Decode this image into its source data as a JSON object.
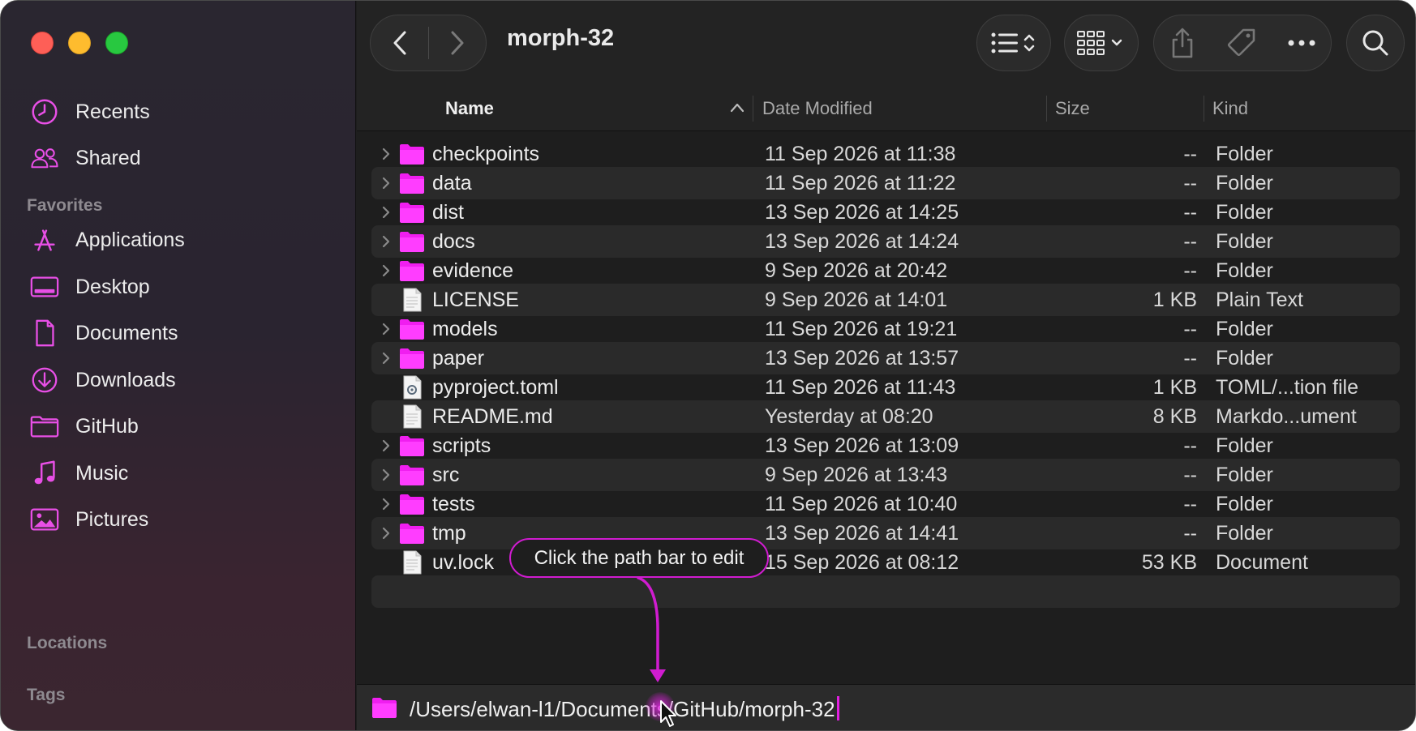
{
  "window": {
    "title": "morph-32"
  },
  "sidebar": {
    "items_top": [
      {
        "label": "Recents",
        "icon": "clock-icon"
      },
      {
        "label": "Shared",
        "icon": "people-icon"
      }
    ],
    "favorites_header": "Favorites",
    "favorites": [
      {
        "label": "Applications",
        "icon": "applications-icon"
      },
      {
        "label": "Desktop",
        "icon": "desktop-icon"
      },
      {
        "label": "Documents",
        "icon": "document-icon"
      },
      {
        "label": "Downloads",
        "icon": "download-icon"
      },
      {
        "label": "GitHub",
        "icon": "folder-icon"
      },
      {
        "label": "Music",
        "icon": "music-icon"
      },
      {
        "label": "Pictures",
        "icon": "pictures-icon"
      }
    ],
    "locations_header": "Locations",
    "tags_header": "Tags"
  },
  "columns": {
    "name": "Name",
    "date": "Date Modified",
    "size": "Size",
    "kind": "Kind"
  },
  "files": [
    {
      "name": "checkpoints",
      "date": "11 Sep 2026 at 11:38",
      "size": "--",
      "kind": "Folder",
      "type": "folder"
    },
    {
      "name": "data",
      "date": "11 Sep 2026 at 11:22",
      "size": "--",
      "kind": "Folder",
      "type": "folder"
    },
    {
      "name": "dist",
      "date": "13 Sep 2026 at 14:25",
      "size": "--",
      "kind": "Folder",
      "type": "folder"
    },
    {
      "name": "docs",
      "date": "13 Sep 2026 at 14:24",
      "size": "--",
      "kind": "Folder",
      "type": "folder"
    },
    {
      "name": "evidence",
      "date": "9 Sep 2026 at 20:42",
      "size": "--",
      "kind": "Folder",
      "type": "folder"
    },
    {
      "name": "LICENSE",
      "date": "9 Sep 2026 at 14:01",
      "size": "1 KB",
      "kind": "Plain Text",
      "type": "text"
    },
    {
      "name": "models",
      "date": "11 Sep 2026 at 19:21",
      "size": "--",
      "kind": "Folder",
      "type": "folder"
    },
    {
      "name": "paper",
      "date": "13 Sep 2026 at 13:57",
      "size": "--",
      "kind": "Folder",
      "type": "folder"
    },
    {
      "name": "pyproject.toml",
      "date": "11 Sep 2026 at 11:43",
      "size": "1 KB",
      "kind": "TOML/...tion file",
      "type": "config"
    },
    {
      "name": "README.md",
      "date": "Yesterday at 08:20",
      "size": "8 KB",
      "kind": "Markdo...ument",
      "type": "text"
    },
    {
      "name": "scripts",
      "date": "13 Sep 2026 at 13:09",
      "size": "--",
      "kind": "Folder",
      "type": "folder"
    },
    {
      "name": "src",
      "date": "9 Sep 2026 at 13:43",
      "size": "--",
      "kind": "Folder",
      "type": "folder"
    },
    {
      "name": "tests",
      "date": "11 Sep 2026 at 10:40",
      "size": "--",
      "kind": "Folder",
      "type": "folder"
    },
    {
      "name": "tmp",
      "date": "13 Sep 2026 at 14:41",
      "size": "--",
      "kind": "Folder",
      "type": "folder"
    },
    {
      "name": "uv.lock",
      "date": "15 Sep 2026 at 08:12",
      "size": "53 KB",
      "kind": "Document",
      "type": "text"
    }
  ],
  "pathbar": {
    "path": "/Users/elwan-l1/Documents/GitHub/morph-32"
  },
  "annotation": {
    "text": "Click the path bar to edit"
  },
  "colors": {
    "accent": "#e11fe0",
    "folder": "#f01ef0"
  }
}
